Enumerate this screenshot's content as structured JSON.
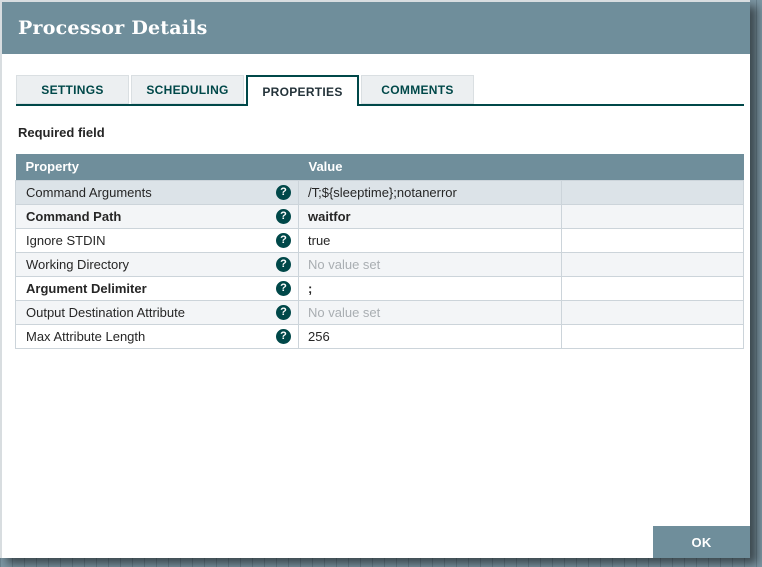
{
  "dialog": {
    "title": "Processor Details",
    "tabs": [
      {
        "label": "SETTINGS",
        "active": false
      },
      {
        "label": "SCHEDULING",
        "active": false
      },
      {
        "label": "PROPERTIES",
        "active": true
      },
      {
        "label": "COMMENTS",
        "active": false
      }
    ],
    "required_field_label": "Required field",
    "table": {
      "columns": [
        "Property",
        "Value"
      ],
      "help_icon_glyph": "?",
      "rows": [
        {
          "property": "Command Arguments",
          "value": "/T;${sleeptime};notanerror",
          "bold": false,
          "value_set": true,
          "selected": true
        },
        {
          "property": "Command Path",
          "value": "waitfor",
          "bold": true,
          "value_set": true,
          "selected": false
        },
        {
          "property": "Ignore STDIN",
          "value": "true",
          "bold": false,
          "value_set": true,
          "selected": false
        },
        {
          "property": "Working Directory",
          "value": "No value set",
          "bold": false,
          "value_set": false,
          "selected": false
        },
        {
          "property": "Argument Delimiter",
          "value": ";",
          "bold": true,
          "value_set": true,
          "selected": false
        },
        {
          "property": "Output Destination Attribute",
          "value": "No value set",
          "bold": false,
          "value_set": false,
          "selected": false
        },
        {
          "property": "Max Attribute Length",
          "value": "256",
          "bold": false,
          "value_set": true,
          "selected": false
        }
      ]
    },
    "ok_button_label": "OK",
    "colors": {
      "titlebar_bg": "#6f8e9b",
      "accent_teal": "#004849",
      "selected_row_bg": "#dce3e8",
      "stripe_row_bg": "#f3f5f7",
      "no_value_text": "#a9aeb2",
      "canvas_bg": "#7d97a4"
    }
  }
}
